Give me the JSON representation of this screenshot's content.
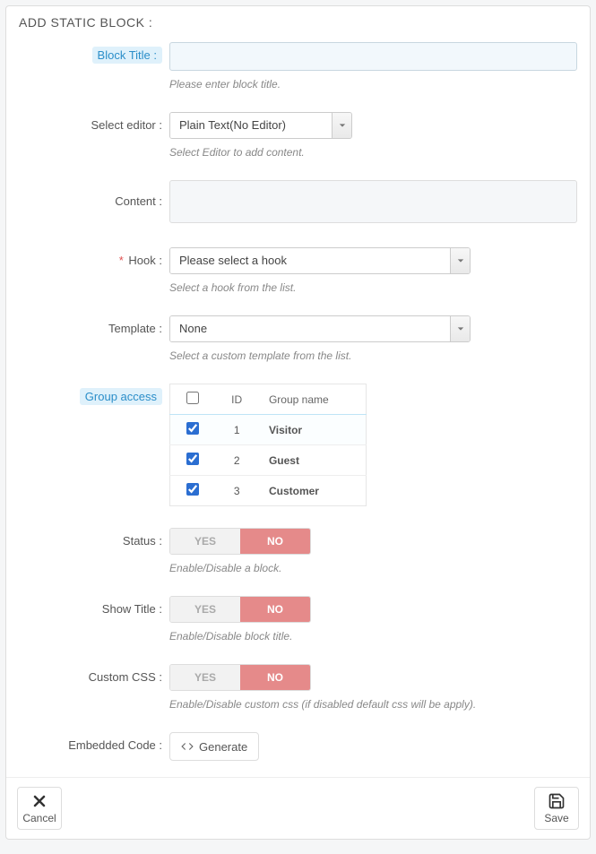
{
  "header": {
    "title": "ADD STATIC BLOCK :"
  },
  "form": {
    "block_title": {
      "label": "Block Title :",
      "value": "",
      "helper": "Please enter block title."
    },
    "editor": {
      "label": "Select editor :",
      "value": "Plain Text(No Editor)",
      "helper": "Select Editor to add content."
    },
    "content": {
      "label": "Content :",
      "value": ""
    },
    "hook": {
      "label": "Hook :",
      "required": "*",
      "value": "Please select a hook",
      "helper": "Select a hook from the list."
    },
    "template": {
      "label": "Template :",
      "value": "None",
      "helper": "Select a custom template from the list."
    },
    "group_access": {
      "label": "Group access",
      "col_id": "ID",
      "col_name": "Group name",
      "rows": [
        {
          "id": "1",
          "name": "Visitor"
        },
        {
          "id": "2",
          "name": "Guest"
        },
        {
          "id": "3",
          "name": "Customer"
        }
      ]
    },
    "status": {
      "label": "Status :",
      "yes": "YES",
      "no": "NO",
      "helper": "Enable/Disable a block."
    },
    "show_title": {
      "label": "Show Title :",
      "yes": "YES",
      "no": "NO",
      "helper": "Enable/Disable block title."
    },
    "custom_css": {
      "label": "Custom CSS :",
      "yes": "YES",
      "no": "NO",
      "helper": "Enable/Disable custom css (if disabled default css will be apply)."
    },
    "embedded": {
      "label": "Embedded Code :",
      "button": "Generate"
    }
  },
  "footer": {
    "cancel": "Cancel",
    "save": "Save"
  }
}
